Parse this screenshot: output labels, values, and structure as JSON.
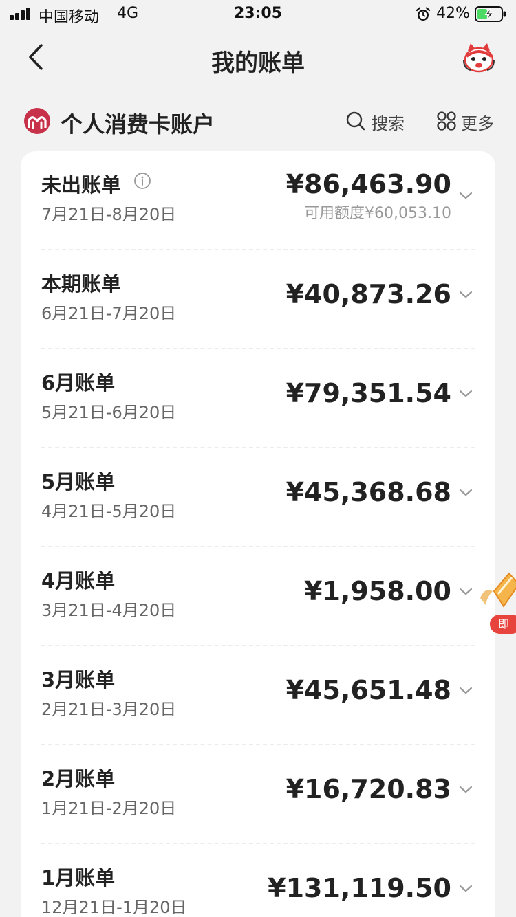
{
  "status_bar": {
    "carrier": "中国移动",
    "network": "4G",
    "time": "23:05",
    "battery": "42%",
    "battery_level": 0.42
  },
  "nav": {
    "title": "我的账单"
  },
  "account": {
    "name": "个人消费卡账户",
    "search_label": "搜索",
    "more_label": "更多",
    "brand_color": "#c8314a"
  },
  "bills": [
    {
      "title": "未出账单",
      "period": "7月21日-8月20日",
      "amount": "¥86,463.90",
      "available": "可用额度¥60,053.10"
    },
    {
      "title": "本期账单",
      "period": "6月21日-7月20日",
      "amount": "¥40,873.26"
    },
    {
      "title": "6月账单",
      "period": "5月21日-6月20日",
      "amount": "¥79,351.54"
    },
    {
      "title": "5月账单",
      "period": "4月21日-5月20日",
      "amount": "¥45,368.68"
    },
    {
      "title": "4月账单",
      "period": "3月21日-4月20日",
      "amount": "¥1,958.00"
    },
    {
      "title": "3月账单",
      "period": "2月21日-3月20日",
      "amount": "¥45,651.48"
    },
    {
      "title": "2月账单",
      "period": "1月21日-2月20日",
      "amount": "¥16,720.83"
    },
    {
      "title": "1月账单",
      "period": "12月21日-1月20日",
      "amount": "¥131,119.50"
    }
  ],
  "promo": {
    "label": "即"
  }
}
